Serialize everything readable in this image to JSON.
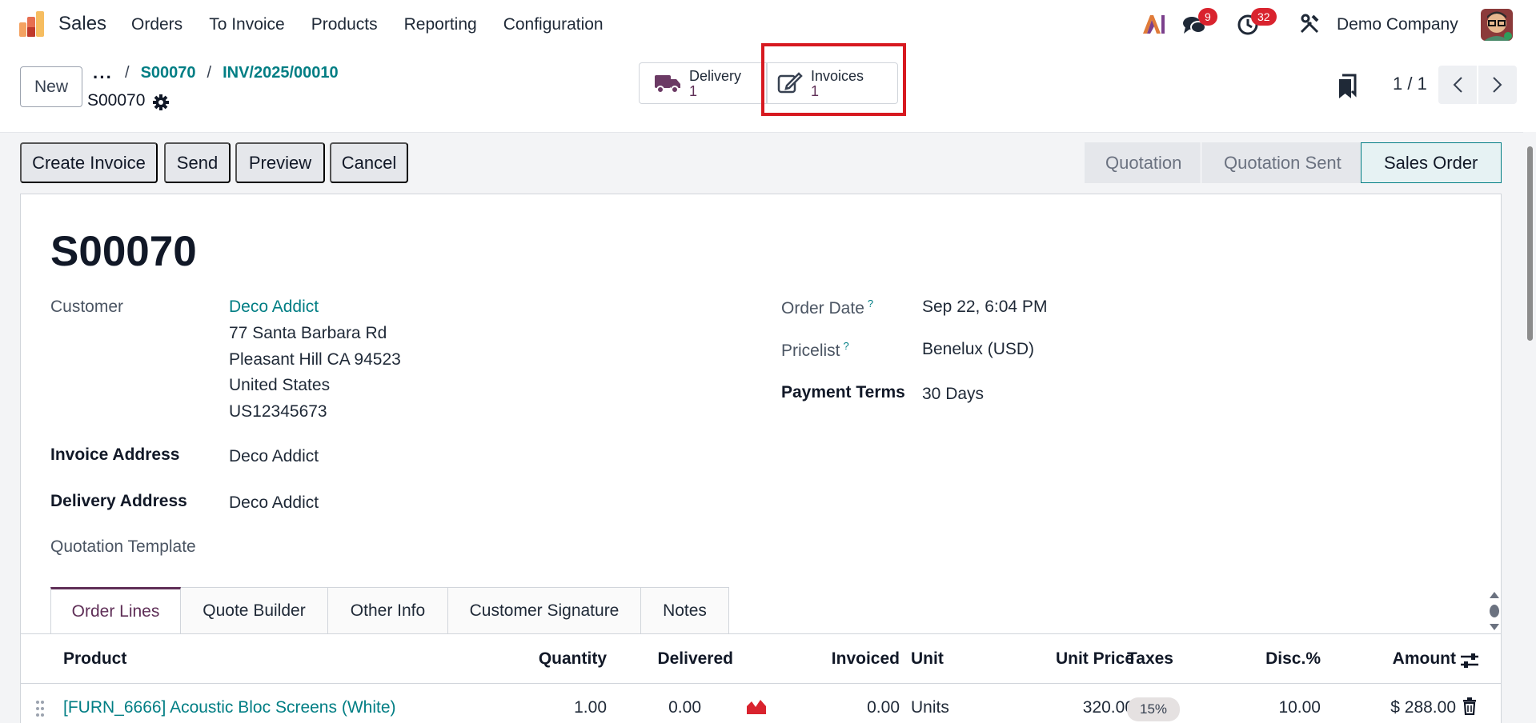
{
  "navbar": {
    "app_name": "Sales",
    "menu": [
      "Orders",
      "To Invoice",
      "Products",
      "Reporting",
      "Configuration"
    ],
    "messages_count": "9",
    "activities_count": "32",
    "company": "Demo Company"
  },
  "control": {
    "new_label": "New",
    "breadcrumb": [
      "S00070",
      "INV/2025/00010"
    ],
    "record_name": "S00070",
    "smart_buttons": [
      {
        "label": "Delivery",
        "count": "1",
        "icon": "truck-icon"
      },
      {
        "label": "Invoices",
        "count": "1",
        "icon": "edit-icon"
      }
    ],
    "pager": "1 / 1"
  },
  "actions": [
    "Create Invoice",
    "Send",
    "Preview",
    "Cancel"
  ],
  "status_stages": [
    "Quotation",
    "Quotation Sent",
    "Sales Order"
  ],
  "active_stage": "Sales Order",
  "form": {
    "title": "S00070",
    "customer_label": "Customer",
    "customer_name": "Deco Addict",
    "customer_address": [
      "77 Santa Barbara Rd",
      "Pleasant Hill CA 94523",
      "United States",
      "US12345673"
    ],
    "invoice_address_label": "Invoice Address",
    "invoice_address": "Deco Addict",
    "delivery_address_label": "Delivery Address",
    "delivery_address": "Deco Addict",
    "quotation_template_label": "Quotation Template",
    "order_date_label": "Order Date",
    "order_date": "Sep 22, 6:04 PM",
    "pricelist_label": "Pricelist",
    "pricelist": "Benelux (USD)",
    "payment_terms_label": "Payment Terms",
    "payment_terms": "30 Days",
    "help_mark": "?"
  },
  "tabs": [
    "Order Lines",
    "Quote Builder",
    "Other Info",
    "Customer Signature",
    "Notes"
  ],
  "table": {
    "columns": [
      "Product",
      "Quantity",
      "Delivered",
      "Invoiced",
      "Unit",
      "Unit Price",
      "Taxes",
      "Disc.%",
      "Amount"
    ],
    "rows": [
      {
        "product": "[FURN_6666] Acoustic Bloc Screens (White)",
        "quantity": "1.00",
        "delivered": "0.00",
        "invoiced": "0.00",
        "unit": "Units",
        "unit_price": "320.00",
        "taxes": "15%",
        "discount": "10.00",
        "amount": "$ 288.00"
      }
    ]
  },
  "colors": {
    "brand": "#5f2f57",
    "link": "#017e84",
    "badge": "#d9232e",
    "highlight": "#d71920"
  }
}
